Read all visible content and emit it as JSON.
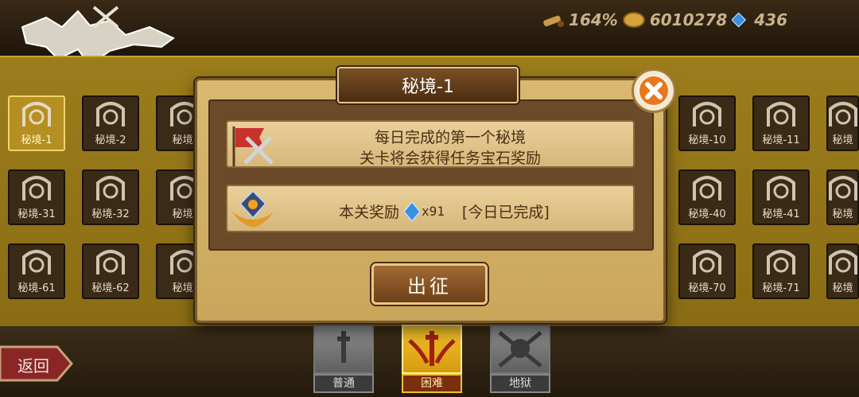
{
  "resources": {
    "map_percent": "164%",
    "gold": "6010278",
    "gems": "436"
  },
  "stages": {
    "row1_left": [
      "秘境-1",
      "秘境-2",
      "秘境-"
    ],
    "row1_right": [
      "秘境-10",
      "秘境-11",
      "秘境"
    ],
    "row2_left": [
      "秘境-31",
      "秘境-32",
      "秘境-"
    ],
    "row2_right": [
      "秘境-40",
      "秘境-41",
      "秘境"
    ],
    "row3_left": [
      "秘境-61",
      "秘境-62",
      "秘境-"
    ],
    "row3_right": [
      "秘境-70",
      "秘境-71",
      "秘境"
    ]
  },
  "back_label": "返回",
  "modes": [
    {
      "label": "普通",
      "icon": "sword-icon"
    },
    {
      "label": "困难",
      "icon": "winged-sword-icon"
    },
    {
      "label": "地狱",
      "icon": "skull-crossed-swords-icon"
    }
  ],
  "dialog": {
    "title": "秘境-1",
    "info_line1": "每日完成的第一个秘境",
    "info_line2": "关卡将会获得任务宝石奖励",
    "reward_label": "本关奖励",
    "reward_qty": "x91",
    "reward_status": "[今日已完成]",
    "go_label": "出征"
  },
  "colors": {
    "accent_gold": "#d9b970",
    "gem_blue": "#3b8fe0",
    "active_mode": "#f2c42a"
  }
}
